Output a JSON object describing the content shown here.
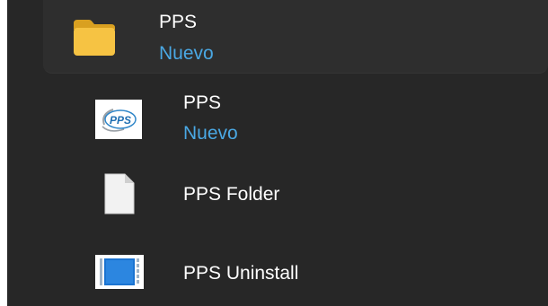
{
  "recent_header": {
    "title": "PPS",
    "subtitle": "Nuevo",
    "icon": "folder-icon"
  },
  "items": [
    {
      "title": "PPS",
      "subtitle": "Nuevo",
      "icon": "pps-app-icon",
      "icon_text": "PPS"
    },
    {
      "title": "PPS Folder",
      "icon": "document-icon"
    },
    {
      "title": "PPS Uninstall",
      "icon": "uninstaller-icon"
    }
  ],
  "colors": {
    "panel_background": "#272727",
    "highlight_background": "#2e2e2e",
    "title_text": "#ffffff",
    "subtitle_text": "#4aa8e4",
    "folder_yellow": "#f6c343"
  }
}
